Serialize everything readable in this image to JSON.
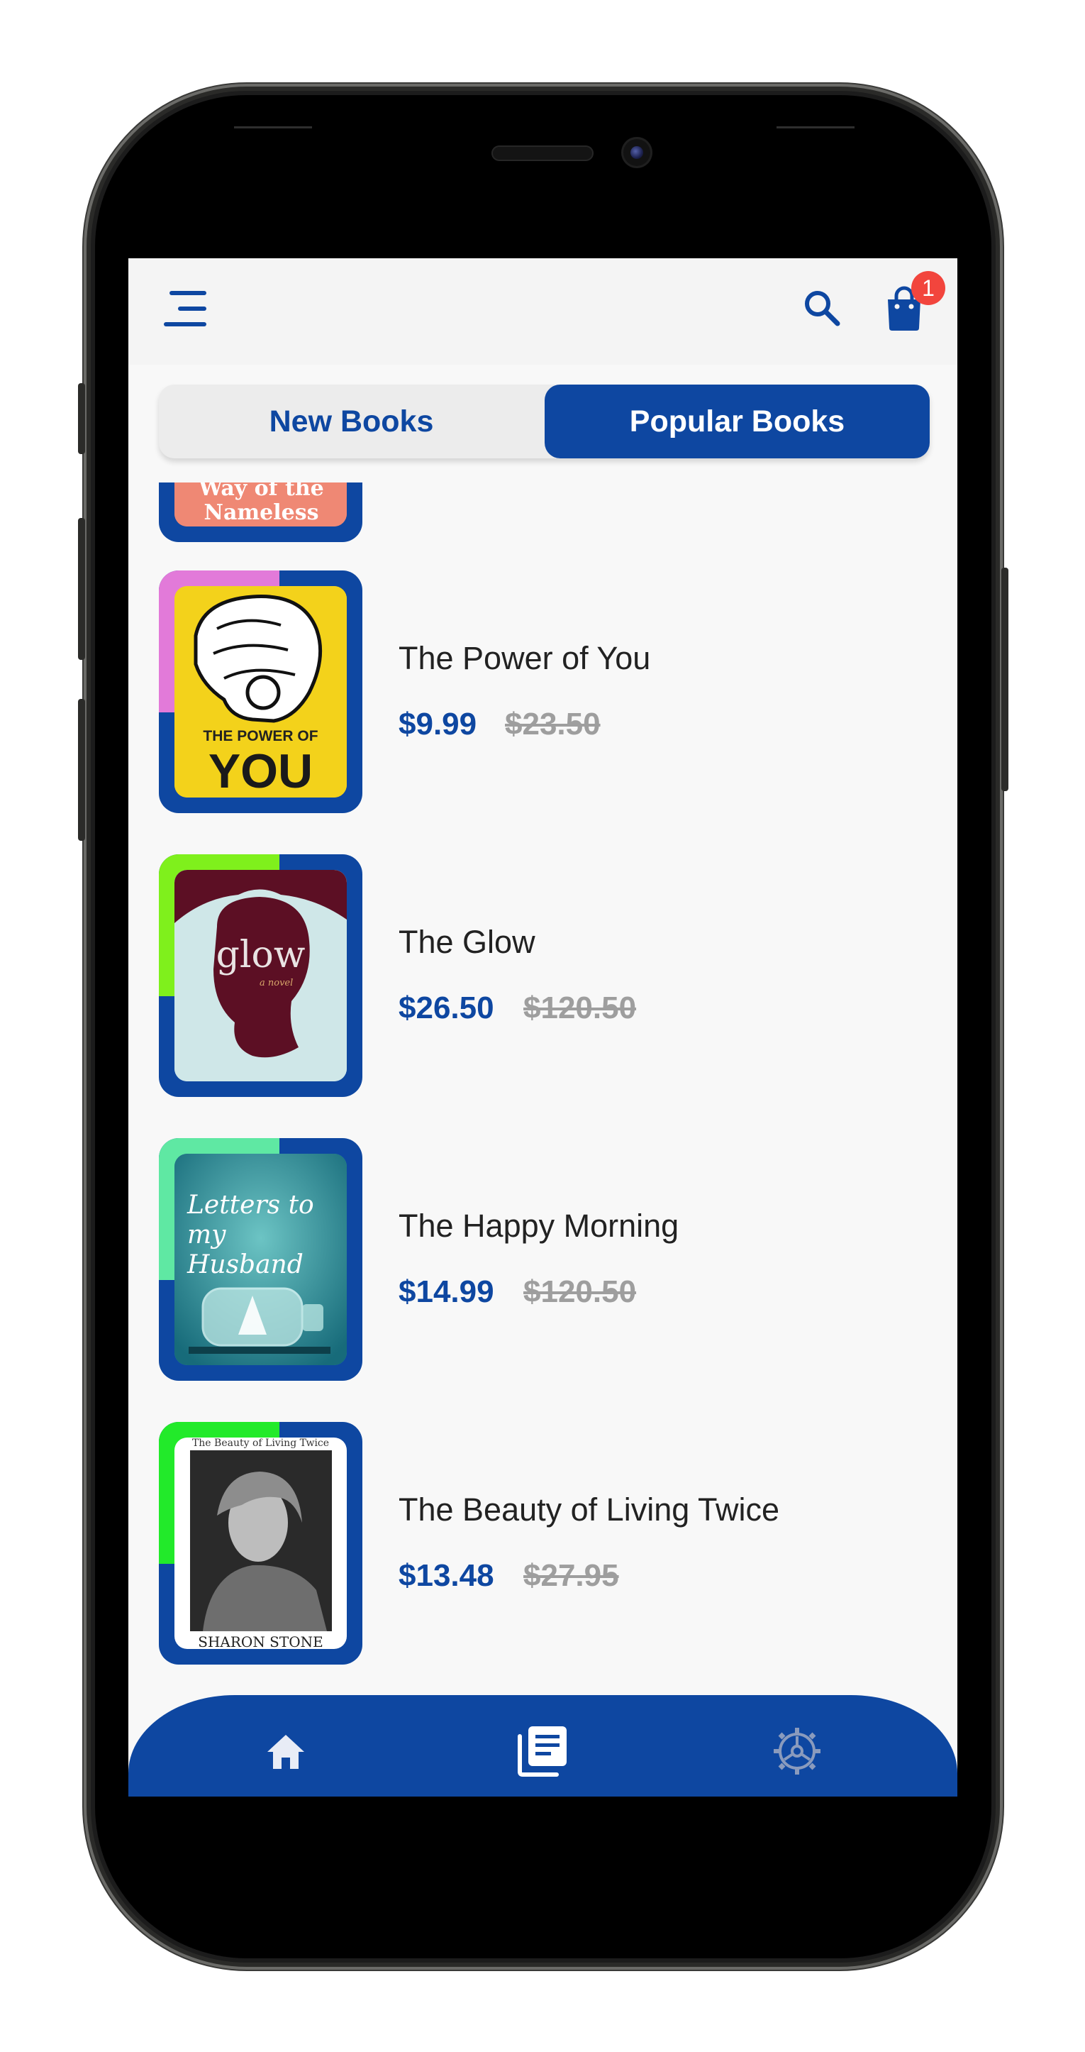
{
  "appbar": {
    "cart_count": "1"
  },
  "tabs": [
    {
      "label": "New Books",
      "selected": false
    },
    {
      "label": "Popular Books",
      "selected": true
    }
  ],
  "partial_book": {
    "cover_text": "Way of the Nameless"
  },
  "books": [
    {
      "title": "The Power of You",
      "price": "$9.99",
      "old_price": "$23.50",
      "cover_text_top": "THE POWER OF",
      "cover_text_bottom": "YOU",
      "accent": "#e27ad9"
    },
    {
      "title": "The Glow",
      "price": "$26.50",
      "old_price": "$120.50",
      "cover_text": "glow",
      "cover_sub": "a novel",
      "accent": "#7ff01c"
    },
    {
      "title": "The Happy Morning",
      "price": "$14.99",
      "old_price": "$120.50",
      "cover_text": "Letters to my Husband",
      "accent": "#5fe8a3"
    },
    {
      "title": "The Beauty of Living Twice",
      "price": "$13.48",
      "old_price": "$27.95",
      "cover_text_top": "The Beauty of Living Twice",
      "cover_text_bottom": "SHARON STONE",
      "accent": "#22ea2a"
    }
  ],
  "bottom_nav": {
    "items": [
      "home-icon",
      "library-icon",
      "settings-icon"
    ],
    "active": "library-icon"
  },
  "colors": {
    "primary": "#0e47a1",
    "badge": "#f2453d",
    "old_price": "#9e9e9e"
  }
}
